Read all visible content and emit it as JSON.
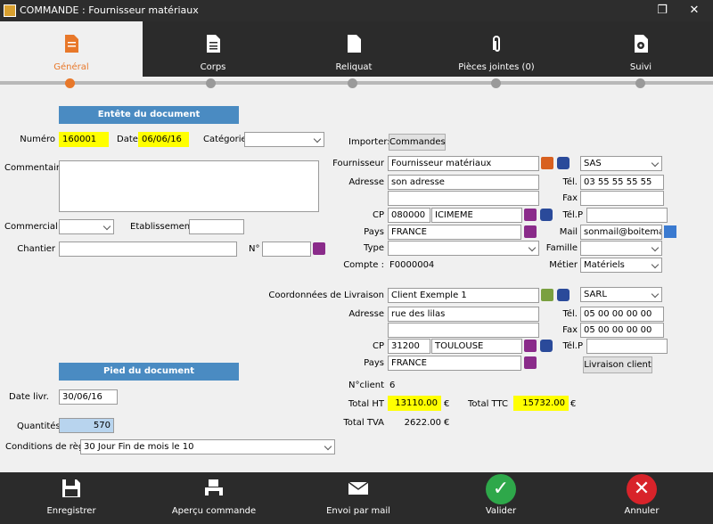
{
  "window": {
    "title": "COMMANDE : Fournisseur matériaux"
  },
  "tabs": [
    {
      "label": "Général"
    },
    {
      "label": "Corps"
    },
    {
      "label": "Reliquat"
    },
    {
      "label": "Pièces jointes (0)"
    },
    {
      "label": "Suivi"
    }
  ],
  "header_section": {
    "title": "Entête du document",
    "numero_label": "Numéro",
    "numero": "160001",
    "date_label": "Date",
    "date": "06/06/16",
    "categorie_label": "Catégorie",
    "categorie": "",
    "commentaire_label": "Commentaire",
    "commentaire": "",
    "commercial_label": "Commercial",
    "commercial": "",
    "etablissement_label": "Etablissement",
    "etablissement": "",
    "chantier_label": "Chantier",
    "chantier": "",
    "no_label": "N°",
    "no": ""
  },
  "footer_section": {
    "title": "Pied du document",
    "date_livr_label": "Date livr.",
    "date_livr": "30/06/16",
    "quantites_label": "Quantités",
    "quantites": "570",
    "conditions_label": "Conditions de règl.",
    "conditions": "30 Jour Fin de mois le 10"
  },
  "supplier": {
    "importer_label": "Importer:",
    "commandes_button": "Commandes",
    "fournisseur_label": "Fournisseur",
    "fournisseur": "Fournisseur matériaux",
    "forme": "SAS",
    "adresse_label": "Adresse",
    "adresse1": "son adresse",
    "adresse2": "",
    "tel_label": "Tél.",
    "tel": "03 55 55 55 55",
    "fax_label": "Fax",
    "fax": "",
    "cp_label": "CP",
    "cp": "080000",
    "ville": "ICIMEME",
    "telp_label": "Tél.P",
    "telp": "",
    "pays_label": "Pays",
    "pays": "FRANCE",
    "mail_label": "Mail",
    "mail": "sonmail@boitemail.fr",
    "type_label": "Type",
    "type": "",
    "famille_label": "Famille",
    "famille": "",
    "compte_label": "Compte :",
    "compte": "F0000004",
    "metier_label": "Métier",
    "metier": "Matériels"
  },
  "delivery": {
    "label": "Coordonnées de Livraison",
    "client": "Client Exemple 1",
    "forme": "SARL",
    "adresse_label": "Adresse",
    "adresse1": "rue des lilas",
    "adresse2": "",
    "tel_label": "Tél.",
    "tel": "05 00 00 00 00",
    "fax_label": "Fax",
    "fax": "05 00 00 00 00",
    "cp_label": "CP",
    "cp": "31200",
    "ville": "TOULOUSE",
    "telp_label": "Tél.P",
    "telp": "",
    "pays_label": "Pays",
    "pays": "FRANCE",
    "livraison_button": "Livraison client",
    "nclient_label": "N°client",
    "nclient": "6"
  },
  "totals": {
    "ht_label": "Total HT",
    "ht": "13110.00",
    "ttc_label": "Total TTC",
    "ttc": "15732.00",
    "tva_label": "Total TVA",
    "tva": "2622.00",
    "currency": "€"
  },
  "bottom": [
    {
      "label": "Enregistrer"
    },
    {
      "label": "Aperçu commande"
    },
    {
      "label": "Envoi par mail"
    },
    {
      "label": "Valider"
    },
    {
      "label": "Annuler"
    }
  ],
  "colors": {
    "accent": "#e8782a",
    "header_blue": "#4a8bc2",
    "highlight": "#ffff00",
    "valider": "#2ea84a",
    "annuler": "#d8232a"
  }
}
